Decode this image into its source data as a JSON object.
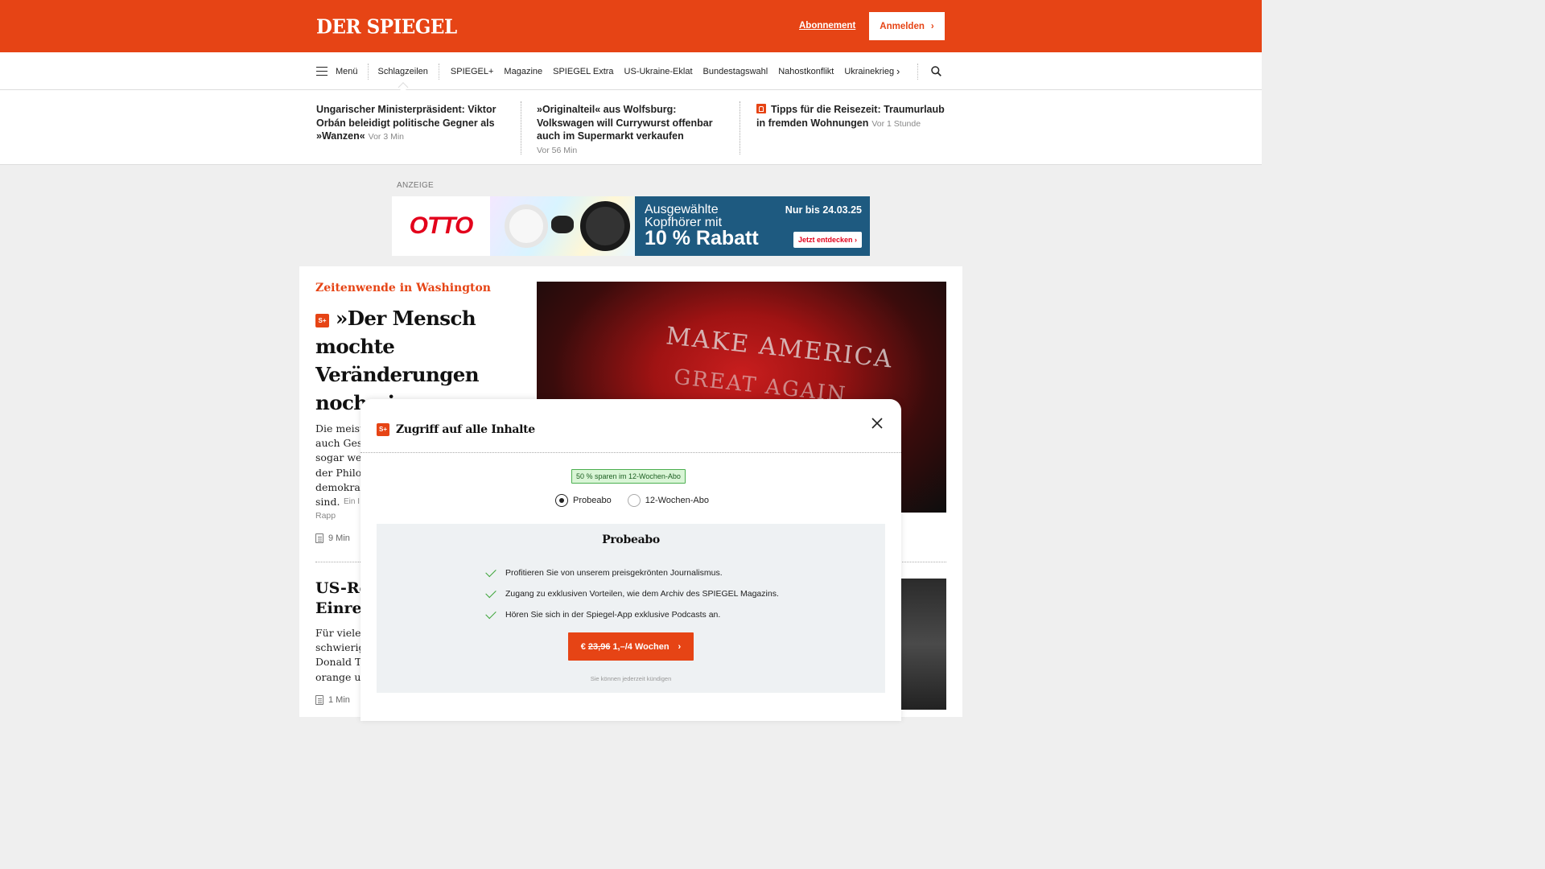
{
  "header": {
    "logo": "DER SPIEGEL",
    "abo_link": "Abonnement",
    "login_label": "Anmelden",
    "brand_color": "#e64415"
  },
  "nav": {
    "menu_label": "Menü",
    "active_item": "Schlagzeilen",
    "items": [
      "SPIEGEL+",
      "Magazine",
      "SPIEGEL Extra",
      "US-Ukraine-Eklat",
      "Bundestagswahl",
      "Nahostkonflikt",
      "Ukrainekrieg"
    ],
    "chevron_icon": "chevron-right-icon",
    "search_icon": "search-icon"
  },
  "headlines": [
    {
      "text": "Ungarischer Ministerpräsident: Viktor Orbán beleidigt politische Gegner als »Wanzen«",
      "time": "Vor 3 Min"
    },
    {
      "text": "»Originalteil« aus Wolfsburg: Volkswagen will Currywurst offenbar auch im Supermarkt verkaufen",
      "time": "Vor 56 Min"
    },
    {
      "text": "Tipps für die Reisezeit: Traumurlaub in fremden Wohnungen",
      "time": "Vor 1 Stunde"
    }
  ],
  "ad": {
    "label": "ANZEIGE",
    "brand": "OTTO",
    "line1": "Ausgewählte",
    "line2": "Kopfhörer mit",
    "discount": "10 % Rabatt",
    "date": "Nur bis 24.03.25",
    "cta": "Jetzt entdecken"
  },
  "article1": {
    "kicker": "Zeitenwende in Washington",
    "badge": "S+",
    "title": "»Der Mensch mochte Veränderungen noch nie«",
    "teaser_lines": [
      "Die meist",
      "auch Gese",
      "sogar wen",
      "der Philos",
      "demokrat",
      "sind."
    ],
    "author_prefix": "Ein I",
    "author_end": "Rapp",
    "read_time": "9 Min",
    "image_text_1": "MAKE AMERICA",
    "image_text_2": "GREAT AGAIN"
  },
  "article2": {
    "title_lines": [
      "US-Re",
      "Einreis"
    ],
    "teaser_lines": [
      "Für viele I",
      "schwierig",
      "Donald Tr",
      "orange un"
    ],
    "read_time": "1 Min"
  },
  "modal": {
    "badge": "S+",
    "title": "Zugriff auf alle Inhalte",
    "save_badge": "50 % sparen im 12-Wochen-Abo",
    "options": [
      {
        "label": "Probeabo",
        "selected": true
      },
      {
        "label": "12-Wochen-Abo",
        "selected": false
      }
    ],
    "offer_title": "Probeabo",
    "benefits": [
      "Profitieren Sie von unserem preisgekrönten Journalismus.",
      "Zugang zu exklusiven Vorteilen, wie dem Archiv des SPIEGEL Magazins.",
      "Hören Sie sich in der Spiegel-App exklusive Podcasts an."
    ],
    "cta_currency": "€",
    "cta_old_price": "23,96",
    "cta_new_price": "1,–/4 Wochen",
    "cancel_note": "Sie können jederzeit kündigen"
  }
}
